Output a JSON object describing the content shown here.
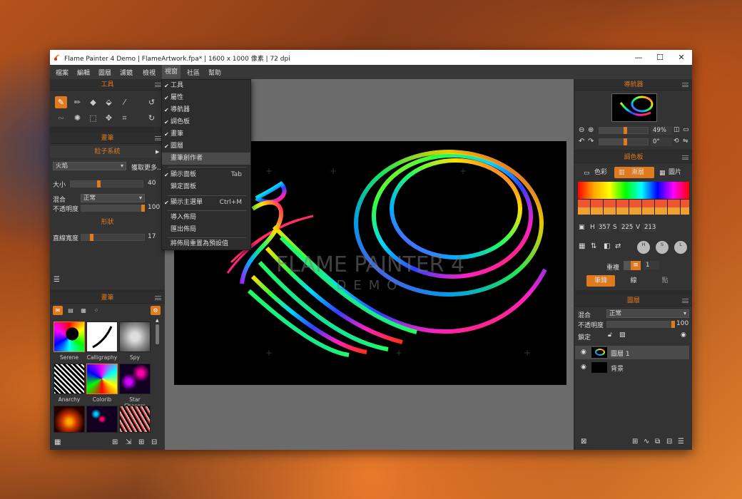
{
  "window": {
    "title": "Flame Painter 4 Demo | FlameArtwork.fpa* | 1600 x 1000 像素 | 72 dpi",
    "minimize": "—",
    "maximize": "☐",
    "close": "✕"
  },
  "menubar": [
    "檔案",
    "編輯",
    "圖層",
    "濾鏡",
    "檢視",
    "視窗",
    "社區",
    "幫助"
  ],
  "view_menu": {
    "items": [
      {
        "label": "工具",
        "checked": true
      },
      {
        "label": "屬性",
        "checked": true
      },
      {
        "label": "導航器",
        "checked": true
      },
      {
        "label": "調色板",
        "checked": true
      },
      {
        "label": "畫筆",
        "checked": true
      },
      {
        "label": "圖層",
        "checked": true
      },
      {
        "label": "畫筆創作者",
        "checked": false,
        "highlighted": true
      },
      {
        "label": "顯示面板",
        "checked": true,
        "shortcut": "Tab"
      },
      {
        "label": "鎖定面板",
        "checked": false
      },
      {
        "label": "顯示主選單",
        "checked": true,
        "shortcut": "Ctrl+M"
      },
      {
        "label": "導入佈局",
        "checked": false
      },
      {
        "label": "匯出佈局",
        "checked": false
      },
      {
        "label": "將佈局重置為預設值",
        "checked": false
      }
    ]
  },
  "tools_panel": {
    "title": "工具"
  },
  "brush_props": {
    "title": "畫筆",
    "particle_system": "粒子系統",
    "brush_name": "火焰",
    "more_button": "獲取更多...",
    "size_label": "大小",
    "size_value": "40",
    "blend_label": "混合",
    "blend_value": "正常",
    "opacity_label": "不透明度",
    "opacity_value": "100",
    "shape_title": "形狀",
    "line_width_label": "直線寬度",
    "line_width_value": "17"
  },
  "brushes_panel": {
    "title": "畫筆",
    "thumbs": [
      {
        "name": "Serene"
      },
      {
        "name": "Calligraphy"
      },
      {
        "name": "Spy"
      },
      {
        "name": "Anarchy"
      },
      {
        "name": "Colorib"
      },
      {
        "name": "Star Chasers"
      },
      {
        "name": ""
      },
      {
        "name": ""
      },
      {
        "name": ""
      }
    ]
  },
  "navigator": {
    "title": "導航器",
    "zoom": "49%",
    "rotation": "0°"
  },
  "palette": {
    "title": "調色板",
    "tabs": [
      "色彩",
      "漸層",
      "圖片"
    ],
    "active_tab": 1,
    "h_label": "H",
    "h_value": "357",
    "s_label": "S",
    "s_value": "225",
    "v_label": "V",
    "v_value": "213",
    "hsl_buttons": [
      "H",
      "S",
      "L"
    ],
    "repeat_label": "重複",
    "repeat_value": "1",
    "mode_tabs": [
      "筆鋒",
      "線",
      "點"
    ]
  },
  "layers": {
    "title": "圖層",
    "blend_label": "混合",
    "blend_value": "正常",
    "opacity_label": "不透明度",
    "opacity_value": "100",
    "lock_label": "鎖定",
    "items": [
      {
        "name": "圖層 1"
      },
      {
        "name": "背景"
      }
    ]
  },
  "canvas": {
    "watermark_line1": "FLAME PAINTER 4",
    "watermark_line2": "DEMO"
  },
  "colors": {
    "accent": "#e07a1f",
    "panel": "#333333",
    "canvas_bg": "#000000"
  }
}
